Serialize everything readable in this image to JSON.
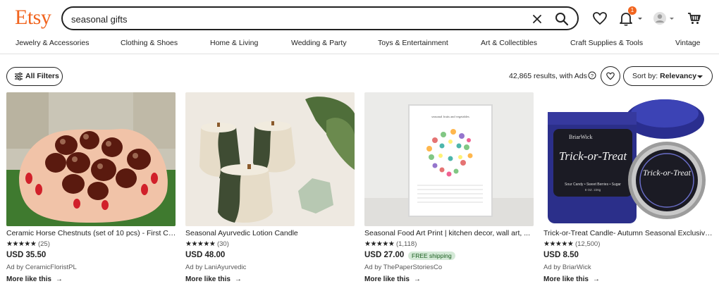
{
  "header": {
    "logo": "Etsy",
    "search_value": "seasonal gifts",
    "cart_badge": "1",
    "icons": [
      "clear-icon",
      "search-icon",
      "heart-icon",
      "bell-icon",
      "avatar-icon",
      "cart-icon"
    ]
  },
  "categories": [
    "Jewelry & Accessories",
    "Clothing & Shoes",
    "Home & Living",
    "Wedding & Party",
    "Toys & Entertainment",
    "Art & Collectibles",
    "Craft Supplies & Tools",
    "Vintage"
  ],
  "toolbar": {
    "filters_label": "All Filters",
    "results_text": "42,865 results, with Ads",
    "sort_prefix": "Sort by:",
    "sort_value": "Relevancy"
  },
  "products": [
    {
      "title": "Ceramic Horse Chestnuts (set of 10 pcs) - First Col...",
      "stars": "★★★★★",
      "reviews": "(25)",
      "price": "USD 35.50",
      "shipping": "",
      "seller": "Ad by CeramicFloristPL",
      "more": "More like this"
    },
    {
      "title": "Seasonal Ayurvedic Lotion Candle",
      "stars": "★★★★★",
      "reviews": "(30)",
      "price": "USD 48.00",
      "shipping": "",
      "seller": "Ad by LaniAyurvedic",
      "more": "More like this"
    },
    {
      "title": "Seasonal Food Art Print | kitchen decor, wall art, ...",
      "stars": "★★★★★",
      "reviews": "(1,118)",
      "price": "USD 27.00",
      "shipping": "FREE shipping",
      "seller": "Ad by ThePaperStoriesCo",
      "more": "More like this"
    },
    {
      "title": "Trick-or-Treat Candle- Autumn Seasonal Exclusive...",
      "stars": "★★★★★",
      "reviews": "(12,500)",
      "price": "USD 8.50",
      "shipping": "",
      "seller": "Ad by BriarWick",
      "more": "More like this"
    }
  ],
  "print_text": {
    "header": "seasonal fruits and vegetables",
    "brand": "BriarWick",
    "candle_title": "Trick-or-Treat",
    "candle_desc": "Sour Candy • Sweet Berries • Sugar",
    "candle_weight": "8 OZ. 226g"
  },
  "colors": {
    "brand": "#f1641e",
    "free_shipping_bg": "#d4e9d7"
  }
}
